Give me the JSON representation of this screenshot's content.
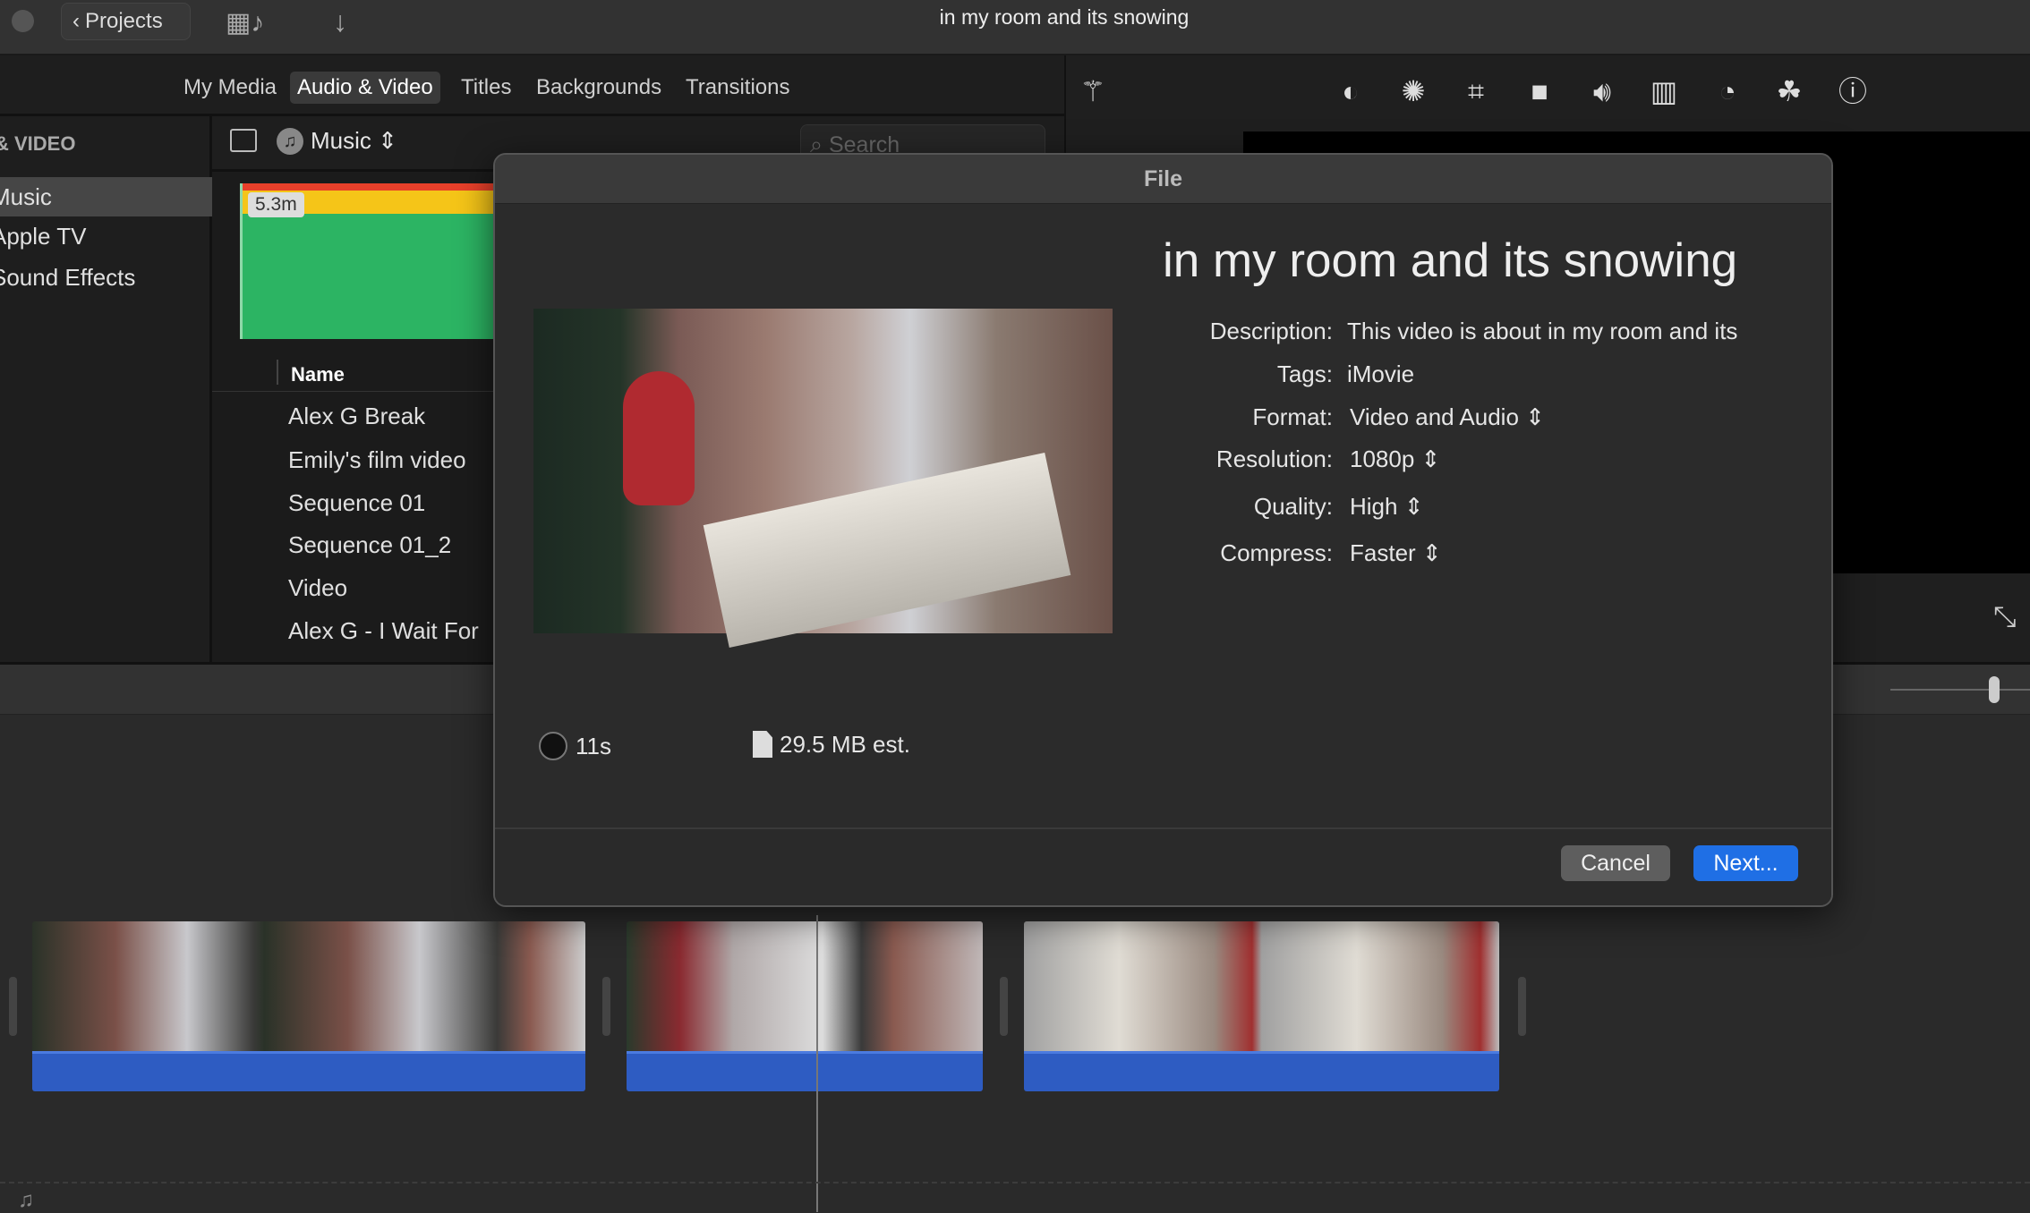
{
  "window": {
    "title": "in my room and its snowing",
    "back_label": "Projects"
  },
  "browser_tabs": [
    {
      "label": "My Media"
    },
    {
      "label": "Audio & Video",
      "selected": true
    },
    {
      "label": "Titles"
    },
    {
      "label": "Backgrounds"
    },
    {
      "label": "Transitions"
    }
  ],
  "toolbar_icons": [
    "magic-wand-icon",
    "color-balance-icon",
    "color-palette-icon",
    "crop-icon",
    "stabilization-icon",
    "volume-icon",
    "equalizer-icon",
    "speed-icon",
    "clip-filter-icon",
    "info-icon"
  ],
  "sidebar": {
    "header": "& VIDEO",
    "items": [
      {
        "label": "Music",
        "selected": true
      },
      {
        "label": "Apple TV"
      },
      {
        "label": "Sound Effects"
      }
    ]
  },
  "library": {
    "source": "Music",
    "search_placeholder": "Search",
    "thumb_duration": "5.3m",
    "column_name": "Name",
    "rows": [
      "Alex G Break",
      "Emily's film video",
      "Sequence 01",
      "Sequence 01_2",
      "Video",
      "Alex G - I Wait For"
    ]
  },
  "dialog": {
    "header": "File",
    "title": "in my room and its snowing",
    "fields": [
      {
        "label": "Description:",
        "value": "This video is about in my room and its"
      },
      {
        "label": "Tags:",
        "value": "iMovie"
      },
      {
        "label": "Format:",
        "value": "Video and Audio",
        "popup": true
      },
      {
        "label": "Resolution:",
        "value": "1080p",
        "popup": true
      },
      {
        "label": "Quality:",
        "value": "High",
        "popup": true
      },
      {
        "label": "Compress:",
        "value": "Faster",
        "popup": true
      }
    ],
    "duration": "11s",
    "size": "29.5 MB est.",
    "cancel": "Cancel",
    "next": "Next..."
  },
  "colors": {
    "accent": "#1f6fe5",
    "audio_wave": "#2e5cc2"
  }
}
